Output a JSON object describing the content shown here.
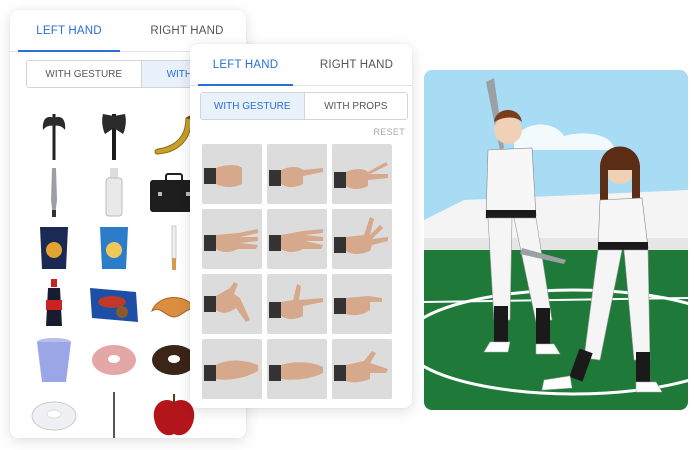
{
  "back_panel": {
    "tabs": [
      {
        "label": "LEFT HAND",
        "active": true
      },
      {
        "label": "RIGHT HAND",
        "active": false
      }
    ],
    "modes": [
      {
        "label": "WITH GESTURE",
        "active": false
      },
      {
        "label": "WITH PROPS",
        "active": true
      }
    ],
    "props": [
      "axe-icon",
      "axe-icon",
      "banana-icon",
      "baseball-bat-icon",
      "bottle-icon",
      "briefcase-icon",
      "chips-bag-icon",
      "chips-bag-icon",
      "cigarette-icon",
      "soda-bottle-icon",
      "cookie-box-icon",
      "croissant-icon",
      "cup-icon",
      "donut-icon",
      "donut-icon",
      "donut-icon",
      "stick-icon",
      "apple-icon"
    ]
  },
  "front_panel": {
    "tabs": [
      {
        "label": "LEFT HAND",
        "active": true
      },
      {
        "label": "RIGHT HAND",
        "active": false
      }
    ],
    "modes": [
      {
        "label": "WITH GESTURE",
        "active": true
      },
      {
        "label": "WITH PROPS",
        "active": false
      }
    ],
    "reset_label": "RESET",
    "gestures": [
      "fist-gesture-icon",
      "pointing-gesture-icon",
      "peace-gesture-icon",
      "three-fingers-gesture-icon",
      "four-fingers-gesture-icon",
      "open-hand-gesture-icon",
      "finger-down-gesture-icon",
      "gun-gesture-icon",
      "curled-hand-gesture-icon",
      "flat-hand-gesture-icon",
      "flat-hand-gesture-icon",
      "relaxed-hand-gesture-icon"
    ]
  },
  "scene": {
    "colors": {
      "sky": "#a8dcf4",
      "field": "#1f7a3a",
      "stands": "#f2f2f2"
    },
    "figures": [
      "boy-batter",
      "girl-batter"
    ]
  }
}
